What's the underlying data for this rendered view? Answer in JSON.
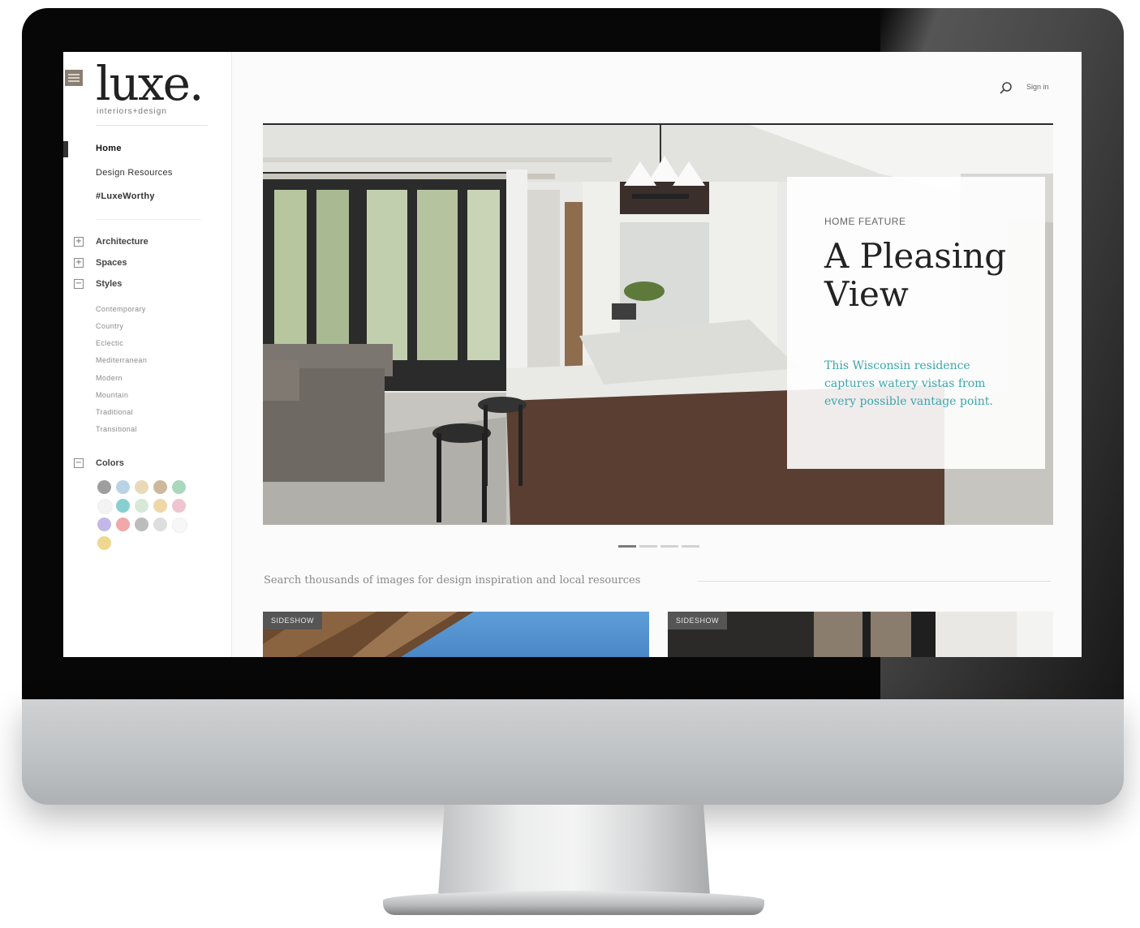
{
  "brand": {
    "name": "luxe.",
    "tagline": "interiors+design"
  },
  "header": {
    "sign_in": "Sign in"
  },
  "nav": {
    "primary": [
      {
        "label": "Home",
        "active": true
      },
      {
        "label": "Design Resources"
      },
      {
        "label": "#LuxeWorthy"
      }
    ],
    "categories": [
      {
        "label": "Architecture",
        "toggle": "+"
      },
      {
        "label": "Spaces",
        "toggle": "+"
      },
      {
        "label": "Styles",
        "toggle": "−"
      }
    ],
    "styles": [
      "Contemporary",
      "Country",
      "Eclectic",
      "Mediterranean",
      "Modern",
      "Mountain",
      "Traditional",
      "Transitional"
    ],
    "colors_label": "Colors",
    "colors_toggle": "−",
    "color_swatches": [
      "#9e9e9e",
      "#b9d3e6",
      "#ead9b9",
      "#cdb89b",
      "#a9d8bd",
      "#f3f3f3",
      "#88cfd0",
      "#d6e9d8",
      "#f0d7a6",
      "#efc3cf",
      "#c2b8e8",
      "#f0a8a8",
      "#bcbcbc",
      "#dedede",
      "#f7f7f7",
      "#f0d78f"
    ]
  },
  "hero": {
    "kicker": "HOME FEATURE",
    "title": "A Pleasing View",
    "description": "This Wisconsin residence captures watery vistas from every possible vantage point."
  },
  "carousel": {
    "slides": 4,
    "active": 1
  },
  "intro": "Search thousands of images for design inspiration and local resources",
  "cards": [
    {
      "tag": "SIDESHOW"
    },
    {
      "tag": "SIDESHOW"
    }
  ],
  "colors": {
    "accent": "#3ba6ad",
    "text": "#222222",
    "bezel": "#070707"
  }
}
